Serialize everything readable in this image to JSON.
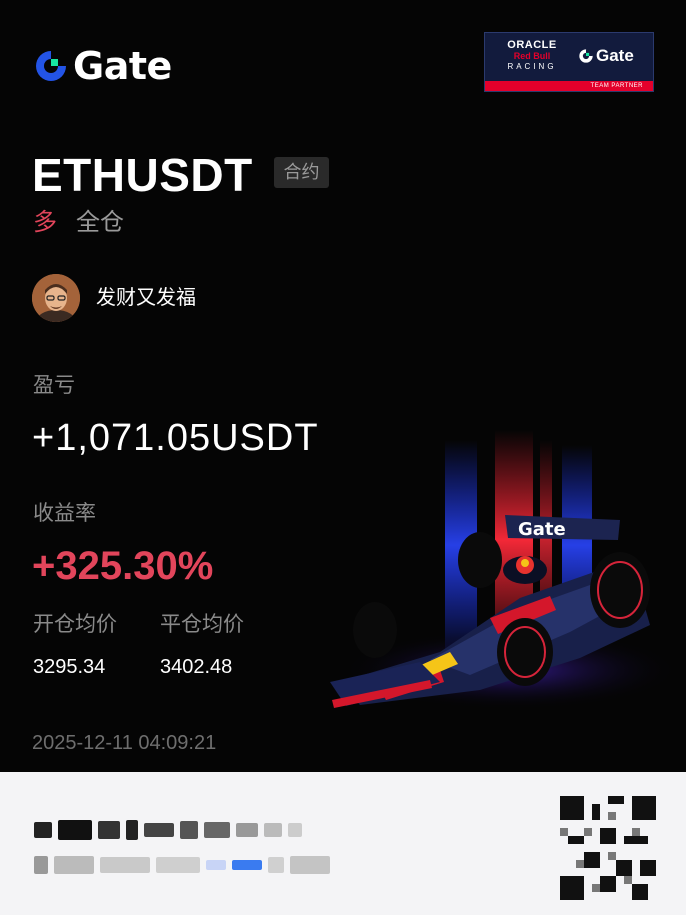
{
  "brand": {
    "name": "Gate",
    "accent": "#2354e6",
    "accent_green": "#17e5a1"
  },
  "partner": {
    "line1": "ORACLE",
    "line2": "Red Bull",
    "line3": "RACING",
    "brand": "Gate",
    "badge": "TEAM PARTNER"
  },
  "position": {
    "symbol": "ETHUSDT",
    "type_tag": "合约",
    "side": "多",
    "margin_mode": "全仓"
  },
  "user": {
    "name": "发财又发福"
  },
  "pnl": {
    "label": "盈亏",
    "value": "+1,071.05USDT"
  },
  "roi": {
    "label": "收益率",
    "value": "+325.30%",
    "color": "#e2455b"
  },
  "prices": {
    "open_label": "开仓均价",
    "open_value": "3295.34",
    "close_label": "平仓均价",
    "close_value": "3402.48"
  },
  "timestamp": "2025-12-11 04:09:21",
  "car": {
    "livery": "Gate"
  }
}
